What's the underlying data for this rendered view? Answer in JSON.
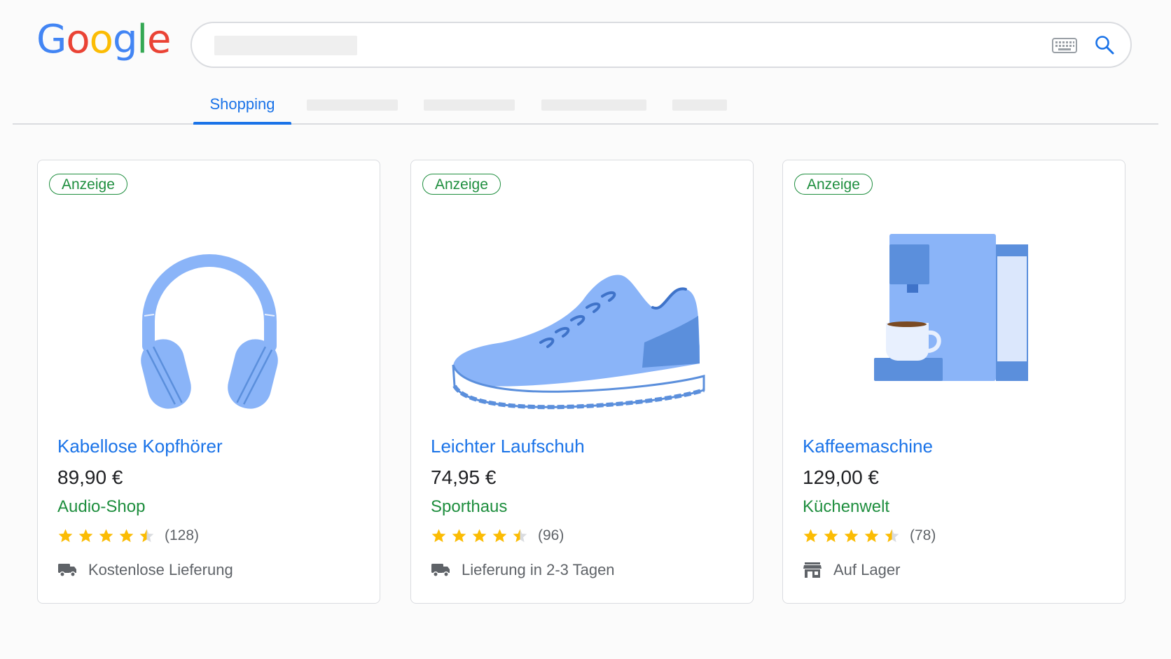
{
  "logo": {
    "letters": [
      "G",
      "o",
      "o",
      "g",
      "l",
      "e"
    ],
    "colors": [
      "#4285F4",
      "#EA4335",
      "#FBBC05",
      "#4285F4",
      "#34A853",
      "#EA4335"
    ]
  },
  "search": {
    "icons": [
      "keyboard-icon",
      "search-icon"
    ]
  },
  "tabs": {
    "active_label": "Shopping"
  },
  "colors": {
    "accent": "#1a73e8",
    "seller": "#1e8e3e",
    "star": "#fbbc04",
    "product": "#8ab4f8"
  },
  "products": [
    {
      "badge": "Anzeige",
      "title": "Kabellose Kopfhörer",
      "price": "89,90 €",
      "seller": "Audio-Shop",
      "rating": 4.5,
      "rating_count": "(128)",
      "delivery_icon": "truck-icon",
      "delivery": "Kostenlose Lieferung",
      "image_icon": "headphones-icon"
    },
    {
      "badge": "Anzeige",
      "title": "Leichter Laufschuh",
      "price": "74,95 €",
      "seller": "Sporthaus",
      "rating": 4.5,
      "rating_count": "(96)",
      "delivery_icon": "truck-icon",
      "delivery": "Lieferung in 2-3 Tagen",
      "image_icon": "sneaker-icon"
    },
    {
      "badge": "Anzeige",
      "title": "Kaffeemaschine",
      "price": "129,00 €",
      "seller": "Küchenwelt",
      "rating": 4.5,
      "rating_count": "(78)",
      "delivery_icon": "store-icon",
      "delivery": "Auf Lager",
      "image_icon": "coffee-machine-icon"
    }
  ]
}
